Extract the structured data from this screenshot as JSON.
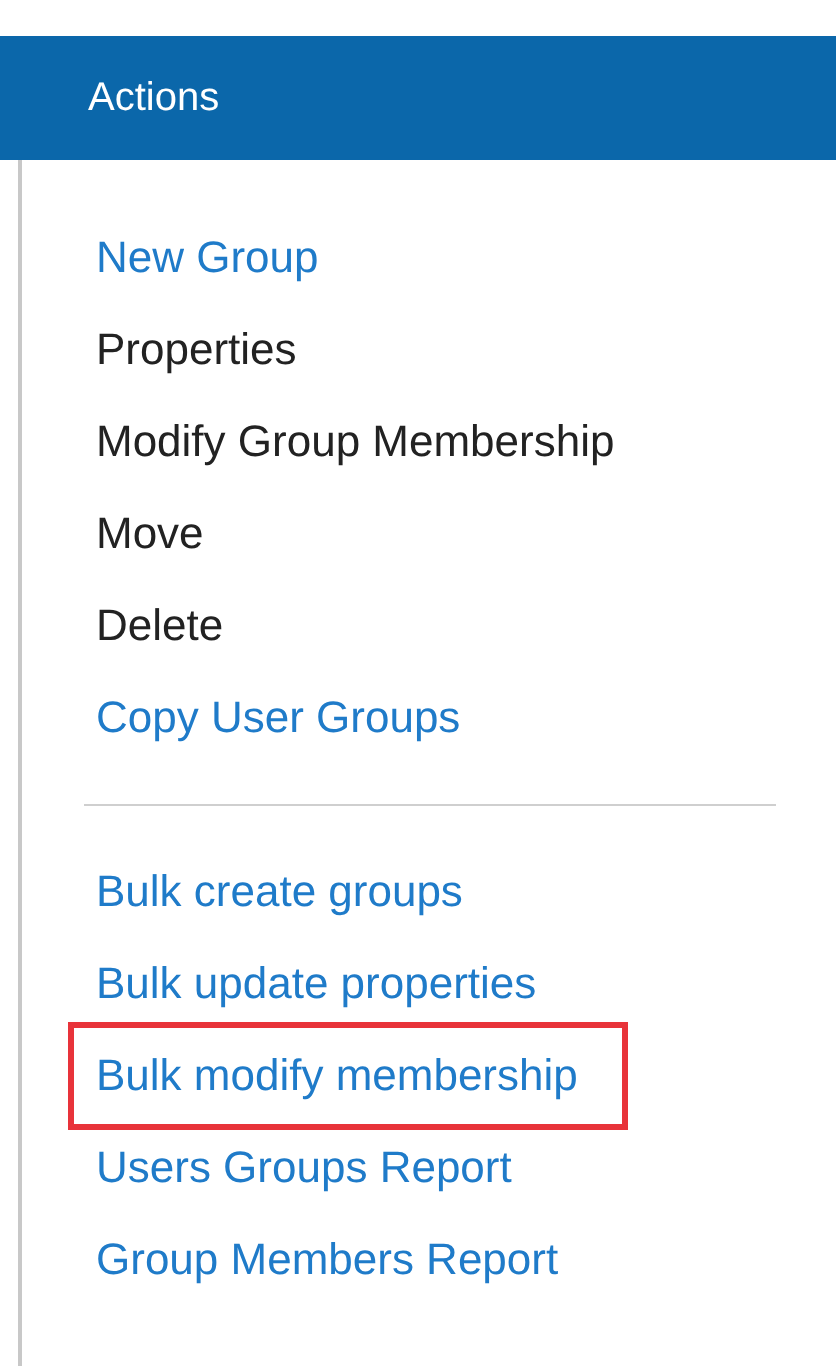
{
  "panel": {
    "title": "Actions"
  },
  "sections": [
    {
      "items": [
        {
          "label": "New Group",
          "kind": "link",
          "highlighted": false
        },
        {
          "label": "Properties",
          "kind": "plain",
          "highlighted": false
        },
        {
          "label": "Modify Group Membership",
          "kind": "plain",
          "highlighted": false
        },
        {
          "label": "Move",
          "kind": "plain",
          "highlighted": false
        },
        {
          "label": "Delete",
          "kind": "plain",
          "highlighted": false
        },
        {
          "label": "Copy User Groups",
          "kind": "link",
          "highlighted": false
        }
      ]
    },
    {
      "items": [
        {
          "label": "Bulk create groups",
          "kind": "link",
          "highlighted": false
        },
        {
          "label": "Bulk update properties",
          "kind": "link",
          "highlighted": false
        },
        {
          "label": "Bulk modify membership",
          "kind": "link",
          "highlighted": true
        },
        {
          "label": "Users Groups Report",
          "kind": "link",
          "highlighted": false
        },
        {
          "label": "Group Members Report",
          "kind": "link",
          "highlighted": false
        }
      ]
    }
  ]
}
